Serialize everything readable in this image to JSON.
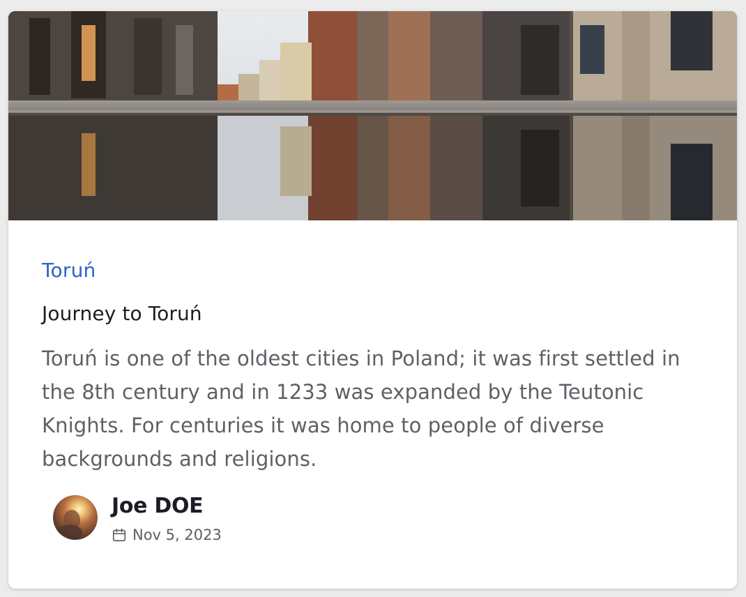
{
  "post": {
    "category": "Toruń",
    "title": "Journey to Toruń",
    "description": "Toruń is one of the oldest cities in Poland; it was first settled in the 8th century and in 1233 was expanded by the Teutonic Knights. For centuries it was home to people of diverse backgrounds and religions."
  },
  "author": {
    "name": "Joe DOE",
    "date": "Nov 5, 2023"
  },
  "icons": {
    "calendar": "calendar-icon"
  },
  "colors": {
    "category": "#2e62c4",
    "title": "#1c1d24",
    "description": "#5f5f66",
    "card_background": "#ffffff",
    "page_background": "#ececec"
  }
}
